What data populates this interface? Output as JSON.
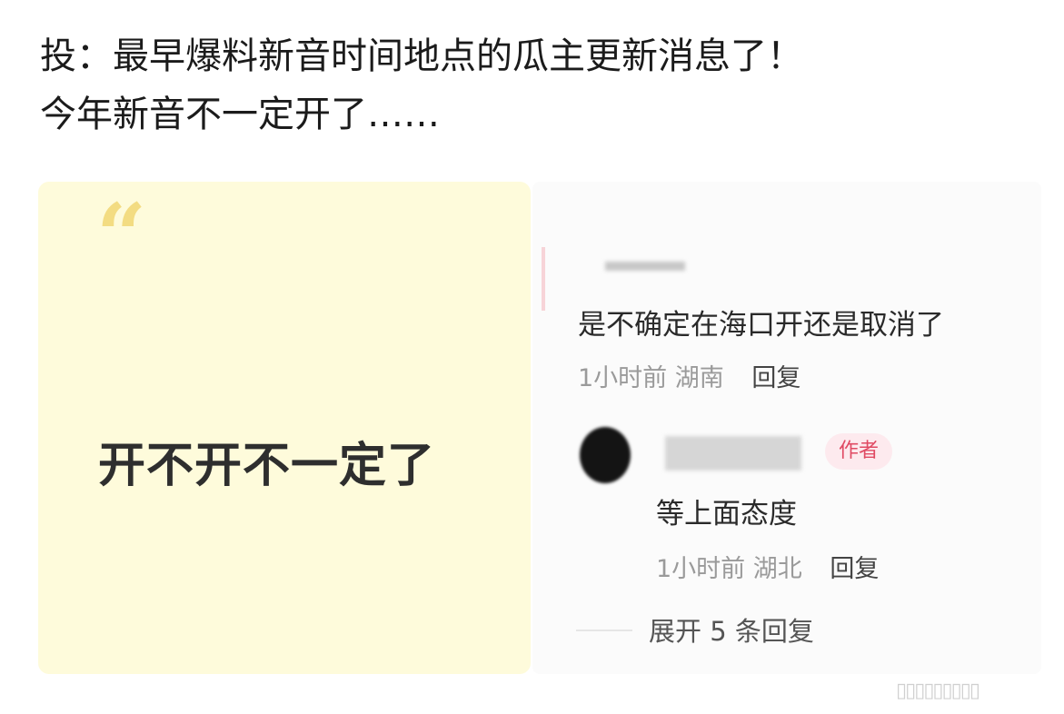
{
  "post": {
    "line1": "投：最早爆料新音时间地点的瓜主更新消息了！",
    "line2": "今年新音不一定开了……"
  },
  "note_card": {
    "quote_glyph": "“",
    "text": "开不开不一定了",
    "background": "#fefbdb",
    "quote_color": "#f3dc82"
  },
  "comment1": {
    "text": "是不确定在海口开还是取消了",
    "time": "1小时前",
    "location": "湖南",
    "reply_label": "回复"
  },
  "comment2": {
    "badge": "作者",
    "text": "等上面态度",
    "time": "1小时前",
    "location": "湖北",
    "reply_label": "回复"
  },
  "expand_label": "展开 5 条回复",
  "watermark": "▯▯▯▯▯▯▯▯▯",
  "colors": {
    "author_badge_bg": "#fdeaee",
    "author_badge_text": "#e04a63"
  }
}
